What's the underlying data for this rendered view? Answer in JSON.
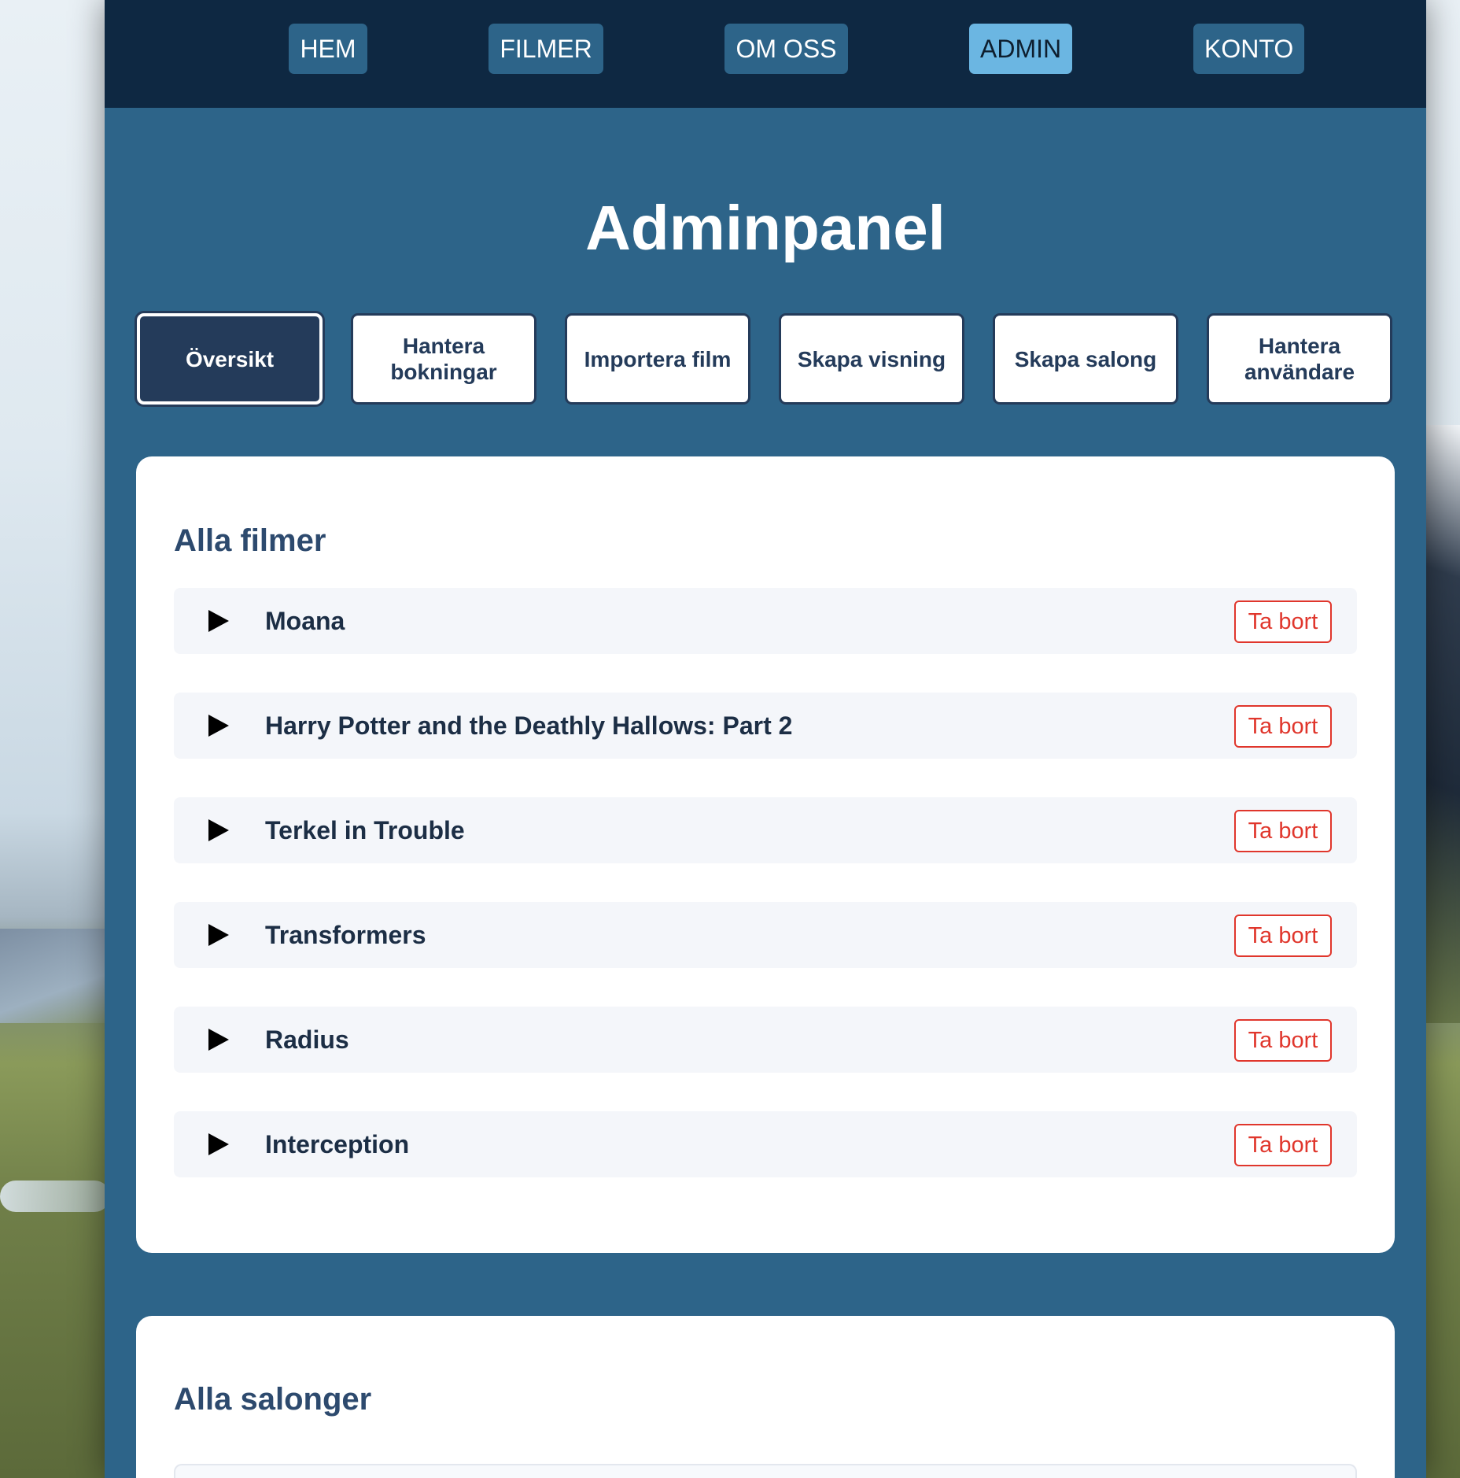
{
  "nav": {
    "items": [
      {
        "label": "HEM",
        "active": false
      },
      {
        "label": "FILMER",
        "active": false
      },
      {
        "label": "OM OSS",
        "active": false
      },
      {
        "label": "ADMIN",
        "active": true
      },
      {
        "label": "KONTO",
        "active": false
      }
    ]
  },
  "page": {
    "title": "Adminpanel"
  },
  "tabs": [
    {
      "label": "Översikt",
      "active": true
    },
    {
      "label": "Hantera bokningar",
      "active": false
    },
    {
      "label": "Importera film",
      "active": false
    },
    {
      "label": "Skapa visning",
      "active": false
    },
    {
      "label": "Skapa salong",
      "active": false
    },
    {
      "label": "Hantera användare",
      "active": false
    }
  ],
  "films": {
    "heading": "Alla filmer",
    "delete_label": "Ta bort",
    "items": [
      {
        "title": "Moana"
      },
      {
        "title": "Harry Potter and the Deathly Hallows: Part 2"
      },
      {
        "title": "Terkel in Trouble"
      },
      {
        "title": "Transformers"
      },
      {
        "title": "Radius"
      },
      {
        "title": "Interception"
      }
    ]
  },
  "salons": {
    "heading": "Alla salonger"
  },
  "colors": {
    "nav_bg": "#0e2842",
    "page_bg": "#2d6489",
    "active_nav": "#6bb6e2",
    "tab_border": "#243b5a",
    "delete": "#e0362c"
  }
}
